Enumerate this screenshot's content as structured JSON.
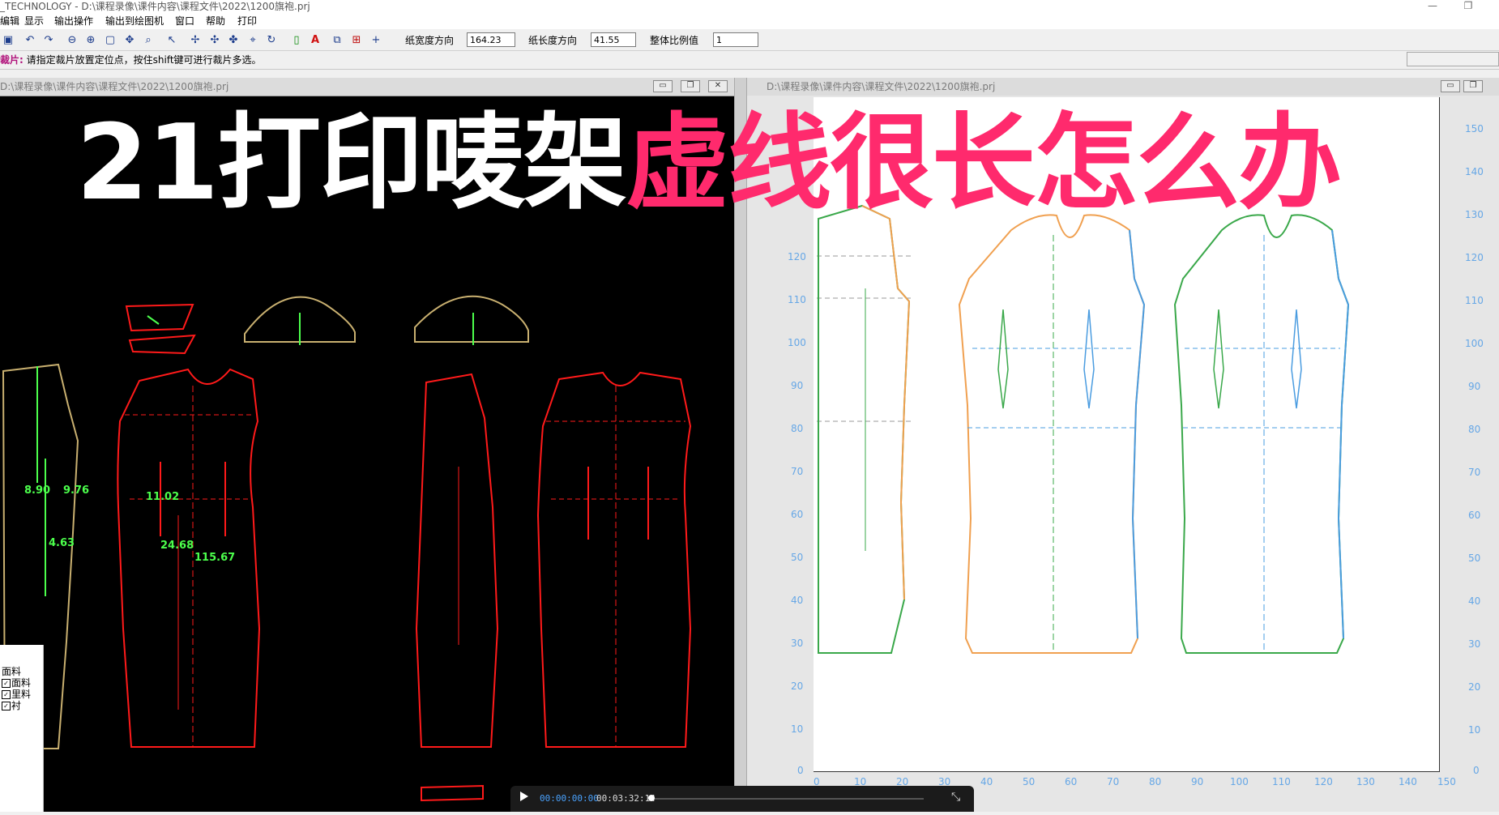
{
  "window": {
    "title": "_TECHNOLOGY - D:\\课程录像\\课件内容\\课程文件\\2022\\1200旗袍.prj",
    "minimize_glyph": "—",
    "restore_glyph": "❐"
  },
  "menu": [
    "编辑",
    "显示",
    "输出操作",
    "输出到绘图机",
    "窗口",
    "帮助",
    "打印"
  ],
  "toolbar": {
    "paper_width_label": "纸宽度方向",
    "paper_width_value": "164.23",
    "paper_length_label": "纸长度方向",
    "paper_length_value": "41.55",
    "scale_label": "整体比例值",
    "scale_value": "1"
  },
  "status": {
    "label": "裁片:",
    "message": "请指定裁片放置定位点，按住shift键可进行裁片多选。"
  },
  "left_pane": {
    "title": "D:\\课程录像\\课件内容\\课程文件\\2022\\1200旗袍.prj",
    "measurements": [
      "8.90",
      "9.76",
      "4.63",
      "11.02",
      "24.68",
      "115.67"
    ]
  },
  "right_pane": {
    "title": "D:\\课程录像\\课件内容\\课程文件\\2022\\1200旗袍.prj",
    "ruler_left": [
      "120",
      "110",
      "100",
      "90",
      "80",
      "70",
      "60",
      "50",
      "40",
      "30",
      "20",
      "10",
      "0"
    ],
    "ruler_right": [
      "150",
      "140",
      "130",
      "120",
      "110",
      "100",
      "90",
      "80",
      "70",
      "60",
      "50",
      "40",
      "30",
      "20",
      "10",
      "0"
    ],
    "ruler_bottom": [
      "0",
      "10",
      "20",
      "30",
      "40",
      "50",
      "60",
      "70",
      "80",
      "90",
      "100",
      "110",
      "120",
      "130",
      "140",
      "150"
    ]
  },
  "legend": {
    "title": "面料",
    "items": [
      "面料",
      "里料",
      "衬"
    ]
  },
  "headline": {
    "white": "21打印唛架",
    "pink": "虚线很长怎么办"
  },
  "video": {
    "current": "00:00:00:00",
    "total": "00:03:32:14"
  },
  "colors": {
    "headline_pink": "#ff2a6d",
    "pattern_red": "#ff1a1a",
    "pattern_green": "#3aa84a",
    "pattern_orange": "#f0a050",
    "pattern_blue": "#4a9ce0",
    "measure_green": "#4cff4c",
    "ruler_blue": "#66a7e6"
  }
}
